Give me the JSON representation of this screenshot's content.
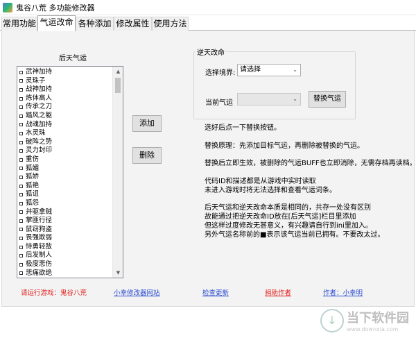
{
  "window": {
    "title": "鬼谷八荒 多功能修改器"
  },
  "tabs": [
    {
      "label": "常用功能"
    },
    {
      "label": "气运改命"
    },
    {
      "label": "各种添加"
    },
    {
      "label": "修改属性"
    },
    {
      "label": "使用方法"
    }
  ],
  "left_panel": {
    "title": "后天气运",
    "items": [
      "武神加持",
      "灵珠子",
      "战神加持",
      "炼体高人",
      "传承之刀",
      "踏风之躯",
      "战魂加持",
      "水灵珠",
      "破阵之势",
      "灵力封印",
      "重伤",
      "狐媚",
      "狐娇",
      "狐艳",
      "狐诅",
      "狐怨",
      "并驱拿贼",
      "掌匪行径",
      "鼠窃狗盗",
      "畏强欺弱",
      "恃勇轻敌",
      "后发制人",
      "极度悲伤",
      "悲痛欲绝"
    ]
  },
  "buttons": {
    "add": "添加",
    "delete": "删除",
    "replace": "替换气运"
  },
  "reverse_fate": {
    "group_title": "逆天改命",
    "realm_label": "选择境界:",
    "realm_value": "请选择",
    "current_label": "当前气运",
    "current_value": ""
  },
  "info_lines": [
    "选好后点一下替换按钮。",
    "替换原理：先添加目标气运，再删除被替换的气运。",
    "替换后立即生效，被删除的气运BUFF也立即消除，无需存档再读档。",
    "代码ID和描述都是从游戏中实时读取",
    "未进入游戏时将无法选择和查看气运词条。",
    "后天气运和逆天改命本质是相同的，共存一处没有区别",
    "故能通过把逆天改命ID放在[后天气运]栏目里添加",
    "但这样过度修改无甚意义，有兴趣请自行到ini里加入。",
    "另外气运名称前的■表示该气运当前已拥有。不要改太过。"
  ],
  "footer": {
    "run_game": "请运行游戏：鬼谷八荒",
    "site_link": "小幸修改器网站",
    "update_link": "检查更新",
    "donate_link": "捐助作者",
    "author_link": "作者：小幸明"
  },
  "watermark": {
    "main": "当下软件园",
    "sub": "www.downxia.com"
  },
  "colors": {
    "footer_red": "#e0201b",
    "link_blue": "#2a4bd0"
  }
}
